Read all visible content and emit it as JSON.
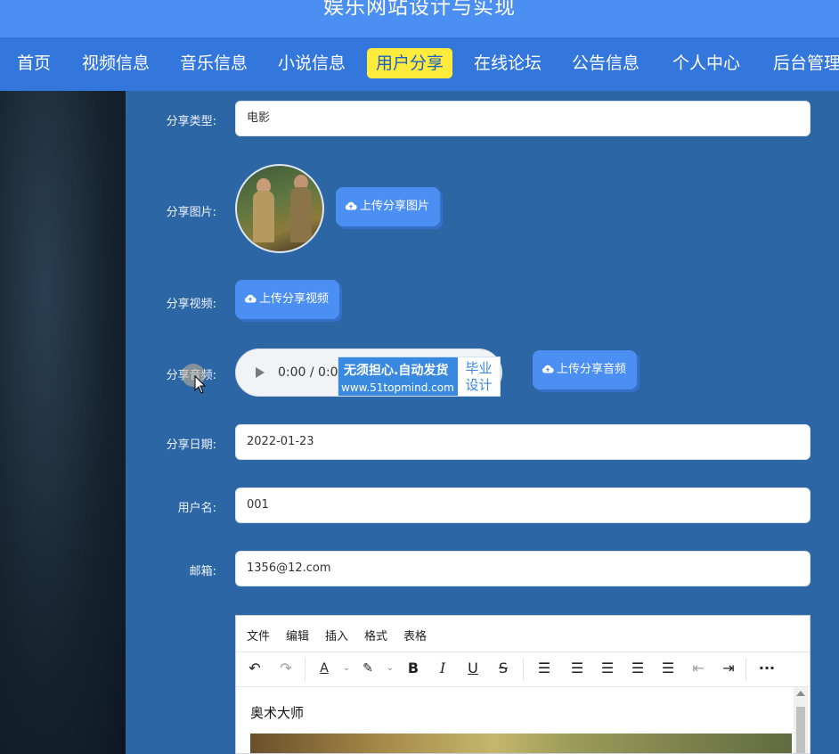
{
  "header": {
    "title": "娱乐网站设计与实现"
  },
  "nav": {
    "items": [
      "首页",
      "视频信息",
      "音乐信息",
      "小说信息",
      "用户分享",
      "在线论坛",
      "公告信息",
      "个人中心",
      "后台管理"
    ],
    "active_index": 4
  },
  "form": {
    "share_type": {
      "label": "分享类型:",
      "value": "电影"
    },
    "share_image": {
      "label": "分享图片:",
      "button": "上传分享图片"
    },
    "share_video": {
      "label": "分享视频:",
      "button": "上传分享视频"
    },
    "share_audio": {
      "label": "分享音频:",
      "time": "0:00 / 0:00",
      "button": "上传分享音频"
    },
    "share_date": {
      "label": "分享日期:",
      "value": "2022-01-23"
    },
    "username": {
      "label": "用户名:",
      "value": "001"
    },
    "email": {
      "label": "邮箱:",
      "value": "1356@12.com"
    }
  },
  "watermark": {
    "line1": "无须担心.自动发货",
    "line2": "www.51topmind.com",
    "badge_line1": "毕业",
    "badge_line2": "设计"
  },
  "editor": {
    "menus": [
      "文件",
      "编辑",
      "插入",
      "格式",
      "表格"
    ],
    "content_text": "奥术大师"
  },
  "colors": {
    "header": "#4c8ff2",
    "nav": "#3377dd",
    "nav_active": "#ffeb3b",
    "panel": "#2d66a5",
    "button": "#4c8ff2"
  }
}
